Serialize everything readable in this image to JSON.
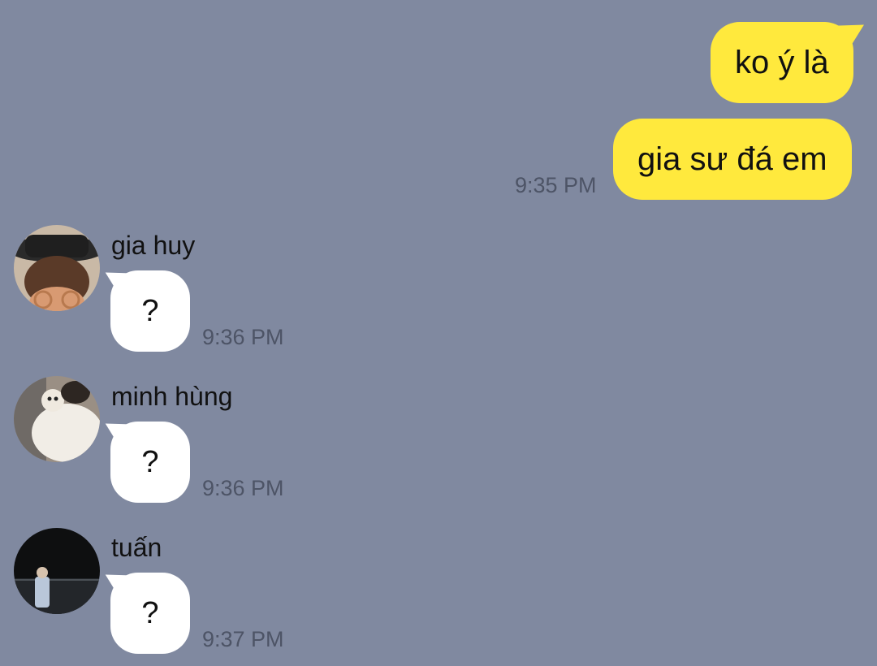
{
  "outgoing": [
    {
      "text": "ko ý là"
    },
    {
      "text": "gia sư đá em"
    }
  ],
  "outgoing_time": "9:35 PM",
  "incoming": [
    {
      "sender": "gia huy",
      "text": "?",
      "time": "9:36 PM",
      "avatar": "avatar-photo-hat-glasses"
    },
    {
      "sender": "minh hùng",
      "text": "?",
      "time": "9:36 PM",
      "avatar": "avatar-photo-stuffed-animal"
    },
    {
      "sender": "tuấn",
      "text": "?",
      "time": "9:37 PM",
      "avatar": "avatar-photo-night-beach"
    }
  ],
  "colors": {
    "background": "#8089a0",
    "outgoing_bubble": "#ffe93d",
    "incoming_bubble": "#ffffff",
    "timestamp": "#4d5466"
  }
}
